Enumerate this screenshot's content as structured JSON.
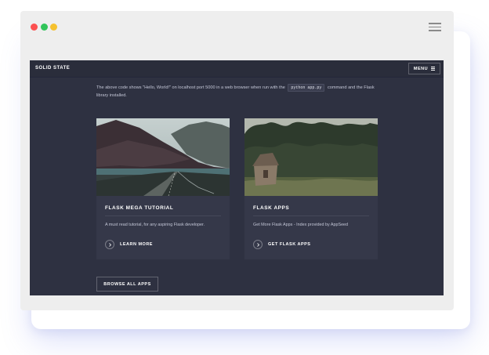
{
  "site": {
    "brand": "SOLID STATE",
    "menu_label": "MENU"
  },
  "intro": {
    "text_before": "The above code shows \"Hello, World!\" on localhost port 5000 in a web browser when run with the",
    "code": "python app.py",
    "text_after": "command and the Flask library installed."
  },
  "cards": [
    {
      "title": "FLASK MEGA TUTORIAL",
      "description": "A must read tutorial, for any aspiring Flask developer.",
      "link_label": "LEARN MORE",
      "image": "mountain-road-photo"
    },
    {
      "title": "FLASK APPS",
      "description": "Get More Flask Apps - Index provided by AppSeed",
      "link_label": "GET FLASK APPS",
      "image": "forest-cabin-photo"
    }
  ],
  "browse_label": "BROWSE ALL APPS",
  "colors": {
    "background": "#2e3141",
    "card": "#353849",
    "topbar": "#2a2d3b",
    "dot_red": "#fc5050",
    "dot_green": "#31c45a",
    "dot_yellow": "#f5c12f"
  }
}
